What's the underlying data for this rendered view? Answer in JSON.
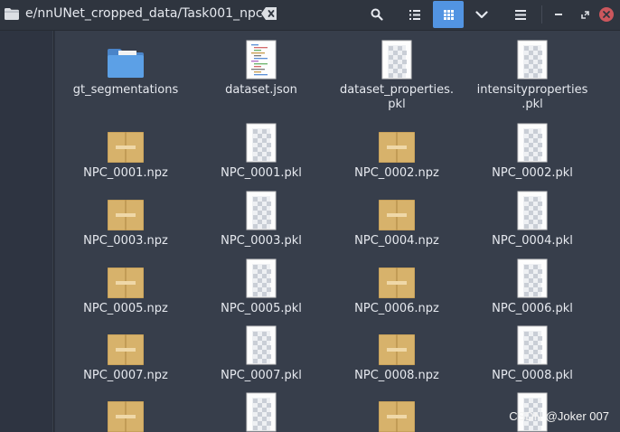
{
  "header": {
    "path": "e/nnUNet_cropped_data/Task001_npc",
    "buttons": [
      {
        "name": "search-button",
        "icon": "search-icon"
      },
      {
        "name": "list-view-button",
        "icon": "list-icon"
      },
      {
        "name": "grid-view-button",
        "icon": "grid-icon",
        "active": true
      },
      {
        "name": "view-options-button",
        "icon": "chevron-down-icon"
      },
      {
        "name": "menu-button",
        "icon": "hamburger-icon"
      },
      {
        "name": "minimize-button",
        "icon": "minimize-icon"
      },
      {
        "name": "maximize-button",
        "icon": "maximize-icon"
      },
      {
        "name": "close-button",
        "icon": "close-icon"
      }
    ]
  },
  "files": [
    {
      "name": "gt_segmentations",
      "type": "folder"
    },
    {
      "name": "dataset.json",
      "type": "json"
    },
    {
      "name": "dataset_properties.\npkl",
      "type": "pkl"
    },
    {
      "name": "intensityproperties\n.pkl",
      "type": "pkl"
    },
    {
      "name": "NPC_0001.npz",
      "type": "npz"
    },
    {
      "name": "NPC_0001.pkl",
      "type": "pkl"
    },
    {
      "name": "NPC_0002.npz",
      "type": "npz"
    },
    {
      "name": "NPC_0002.pkl",
      "type": "pkl"
    },
    {
      "name": "NPC_0003.npz",
      "type": "npz"
    },
    {
      "name": "NPC_0003.pkl",
      "type": "pkl"
    },
    {
      "name": "NPC_0004.npz",
      "type": "npz"
    },
    {
      "name": "NPC_0004.pkl",
      "type": "pkl"
    },
    {
      "name": "NPC_0005.npz",
      "type": "npz"
    },
    {
      "name": "NPC_0005.pkl",
      "type": "pkl"
    },
    {
      "name": "NPC_0006.npz",
      "type": "npz"
    },
    {
      "name": "NPC_0006.pkl",
      "type": "pkl"
    },
    {
      "name": "NPC_0007.npz",
      "type": "npz"
    },
    {
      "name": "NPC_0007.pkl",
      "type": "pkl"
    },
    {
      "name": "NPC_0008.npz",
      "type": "npz"
    },
    {
      "name": "NPC_0008.pkl",
      "type": "pkl"
    },
    {
      "name": "",
      "type": "npz"
    },
    {
      "name": "",
      "type": "pkl"
    },
    {
      "name": "",
      "type": "npz"
    },
    {
      "name": "",
      "type": "pkl"
    }
  ],
  "watermark": "CSDN @Joker 007",
  "colors": {
    "accent": "#5294e2",
    "close": "#cc575d",
    "folder": "#5ca0e6",
    "archive": "#d7b26b"
  }
}
